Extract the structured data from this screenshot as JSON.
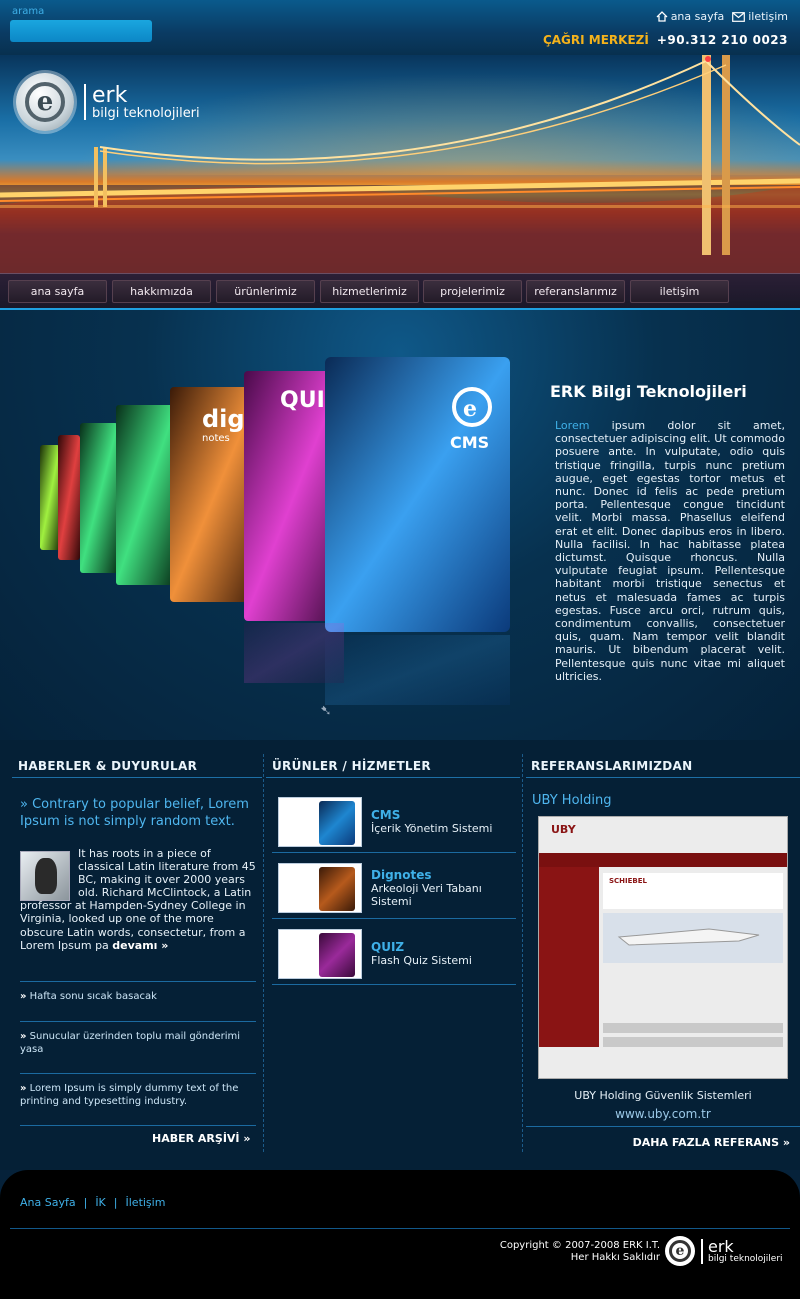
{
  "header": {
    "search_label": "arama",
    "search_value": "",
    "links": [
      {
        "label": "ana sayfa",
        "icon": "home-icon"
      },
      {
        "label": "iletişim",
        "icon": "mail-icon"
      }
    ],
    "call_label": "ÇAĞRI MERKEZİ",
    "call_number": "+90.312 210 0023"
  },
  "brand": {
    "name": "erk",
    "sub": "bilgi teknolojileri",
    "logo_letter": "e"
  },
  "nav": [
    "ana sayfa",
    "hakkımızda",
    "ürünlerimiz",
    "hizmetlerimiz",
    "projelerimiz",
    "referanslarımız",
    "iletişim"
  ],
  "hero": {
    "title": "ERK Bilgi Teknolojileri",
    "accent_word": "Lorem",
    "text": " ipsum dolor sit amet, consectetuer adipiscing elit. Ut commodo posuere ante. In vulputate, odio quis tristique fringilla, turpis nunc pretium augue, eget egestas tortor metus et nunc. Donec id felis ac pede pretium porta. Pellentesque congue tincidunt velit. Morbi massa. Phasellus eleifend erat et elit. Donec dapibus eros in libero. Nulla facilisi. In hac habitasse platea dictumst. Quisque rhoncus. Nulla vulputate feugiat ipsum. Pellentesque habitant morbi tristique senectus et netus et malesuada fames ac turpis egestas. Fusce arcu orci, rutrum quis, condimentum convallis, consectetuer quis, quam. Nam tempor velit blandit mauris. Ut bibendum placerat velit. Pellentesque quis nunc vitae mi aliquet ultricies.",
    "box_labels": {
      "cms": "CMS",
      "quiz": "QUI",
      "dig": "dig",
      "dig_sub": "notes"
    }
  },
  "news": {
    "heading": "HABERLER & DUYURULAR",
    "lead": "» Contrary to popular belief, Lorem Ipsum is not simply random text.",
    "body": "It has roots in a piece of classical Latin literature from 45 BC, making it over 2000 years old. Richard McClintock, a Latin professor at Hampden-Sydney College in Virginia, looked up one of the more obscure Latin words, consectetur, from a Lorem Ipsum pa",
    "more": "devamı »",
    "items": [
      "Hafta sonu sıcak basacak",
      "Sunucular üzerinden toplu mail gönderimi yasa",
      "Lorem Ipsum is simply dummy text of the printing and typesetting industry."
    ],
    "archive": "HABER ARŞİVİ »"
  },
  "products": {
    "heading": "ÜRÜNLER / HİZMETLER",
    "items": [
      {
        "name": "CMS",
        "desc": "İçerik Yönetim Sistemi",
        "color": "#1e86d0"
      },
      {
        "name": "Dignotes",
        "desc": "Arkeoloji Veri Tabanı Sistemi",
        "color": "#b65a1c"
      },
      {
        "name": "QUIZ",
        "desc": "Flash Quiz Sistemi",
        "color": "#9a2a9a"
      }
    ]
  },
  "references": {
    "heading": "REFERANSLARIMIZDAN",
    "sub": "UBY Holding",
    "caption": "UBY Holding Güvenlik Sistemleri",
    "url": "www.uby.com.tr",
    "more": "DAHA FAZLA REFERANS »",
    "shot_logo": "UBY",
    "shot_brand": "SCHIEBEL"
  },
  "footer": {
    "links": [
      "Ana Sayfa",
      "İK",
      "İletişim"
    ],
    "separator": "|",
    "copyright": "Copyright © 2007-2008 ERK I.T.",
    "rights": "Her Hakkı Saklıdır"
  }
}
